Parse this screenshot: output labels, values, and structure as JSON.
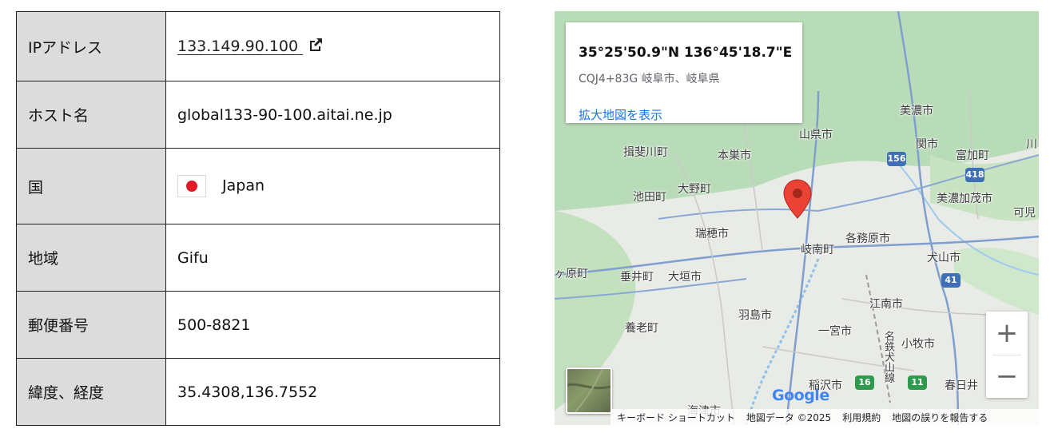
{
  "table": {
    "rows": [
      {
        "label": "IPアドレス",
        "value": "133.149.90.100"
      },
      {
        "label": "ホスト名",
        "value": "global133-90-100.aitai.ne.jp"
      },
      {
        "label": "国",
        "value": "Japan"
      },
      {
        "label": "地域",
        "value": "Gifu"
      },
      {
        "label": "郵便番号",
        "value": "500-8821"
      },
      {
        "label": "緯度、経度",
        "value": "35.4308,136.7552"
      }
    ]
  },
  "icons": {
    "ip_link": "external-link-icon",
    "country_flag": "japan-flag-icon",
    "marker": "map-marker-icon"
  },
  "colors": {
    "label_bg": "#dcdcdc",
    "link_blue": "#1a73e8",
    "marker_red": "#ea4335"
  },
  "map": {
    "info_card": {
      "coords": "35°25'50.9\"N 136°45'18.7\"E",
      "plus_code": "CQJ4+83G 岐阜市、岐阜県",
      "link": "拡大地図を表示"
    },
    "places": [
      "美濃市",
      "山県市",
      "揖斐川町",
      "本巣市",
      "関市",
      "富加町",
      "大野町",
      "池田町",
      "美濃加茂市",
      "瑞穂市",
      "各務原市",
      "岐南町",
      "ヶ原町",
      "垂井町",
      "大垣市",
      "犬山市",
      "江南市",
      "羽島市",
      "養老町",
      "一宮市",
      "小牧市",
      "稲沢市",
      "春日井",
      "海津市",
      "川",
      "可児"
    ],
    "routes": [
      "156",
      "418",
      "41",
      "16",
      "11"
    ],
    "rail_label": "名鉄犬山線",
    "zoom_in": "+",
    "zoom_out": "−",
    "logo": "Google",
    "attribution": [
      "キーボード ショートカット",
      "地図データ ©2025",
      "利用規約",
      "地図の誤りを報告する"
    ]
  }
}
